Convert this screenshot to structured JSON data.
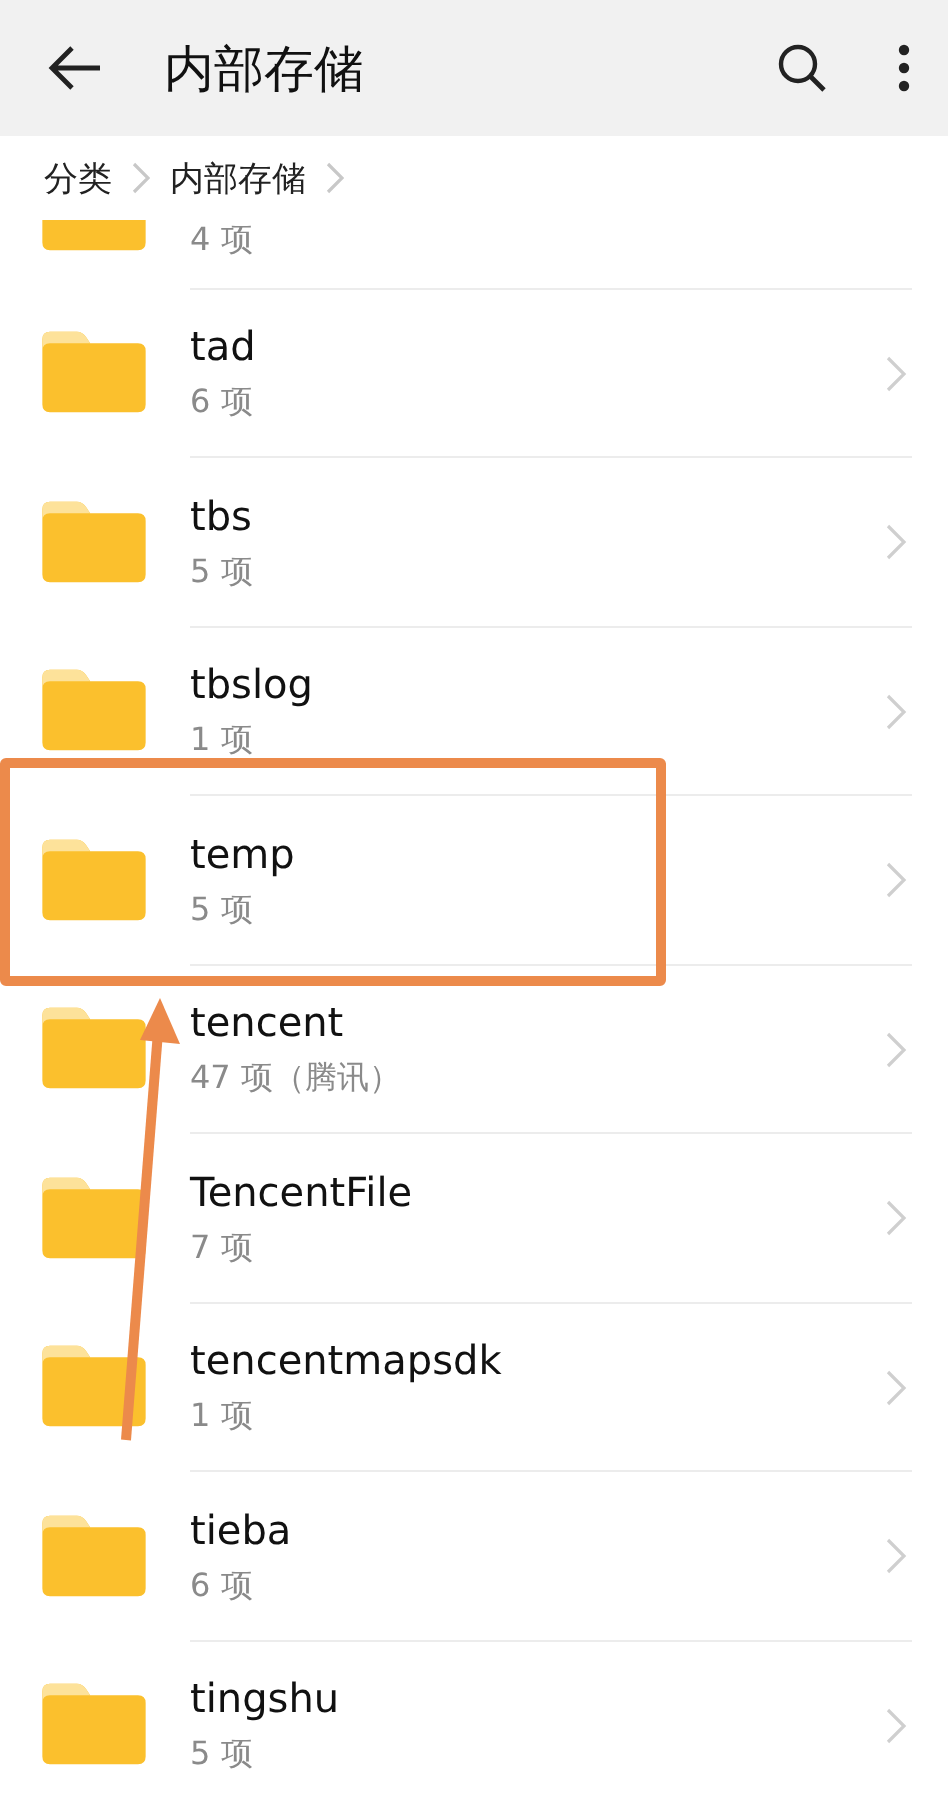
{
  "app_bar": {
    "title": "内部存储"
  },
  "breadcrumb": [
    "分类",
    "内部存储"
  ],
  "folders": [
    {
      "count": "4 项",
      "highlighted": false
    },
    {
      "name": "tad",
      "count": "6 项",
      "highlighted": false
    },
    {
      "name": "tbs",
      "count": "5 项",
      "highlighted": false
    },
    {
      "name": "tbslog",
      "count": "1 项",
      "highlighted": false
    },
    {
      "name": "temp",
      "count": "5 项",
      "highlighted": true
    },
    {
      "name": "tencent",
      "count": "47 项（腾讯）",
      "highlighted": false
    },
    {
      "name": "TencentFile",
      "count": "7 项",
      "highlighted": false
    },
    {
      "name": "tencentmapsdk",
      "count": "1 项",
      "highlighted": false
    },
    {
      "name": "tieba",
      "count": "6 项",
      "highlighted": false
    },
    {
      "name": "tingshu",
      "count": "5 项",
      "highlighted": false
    }
  ]
}
